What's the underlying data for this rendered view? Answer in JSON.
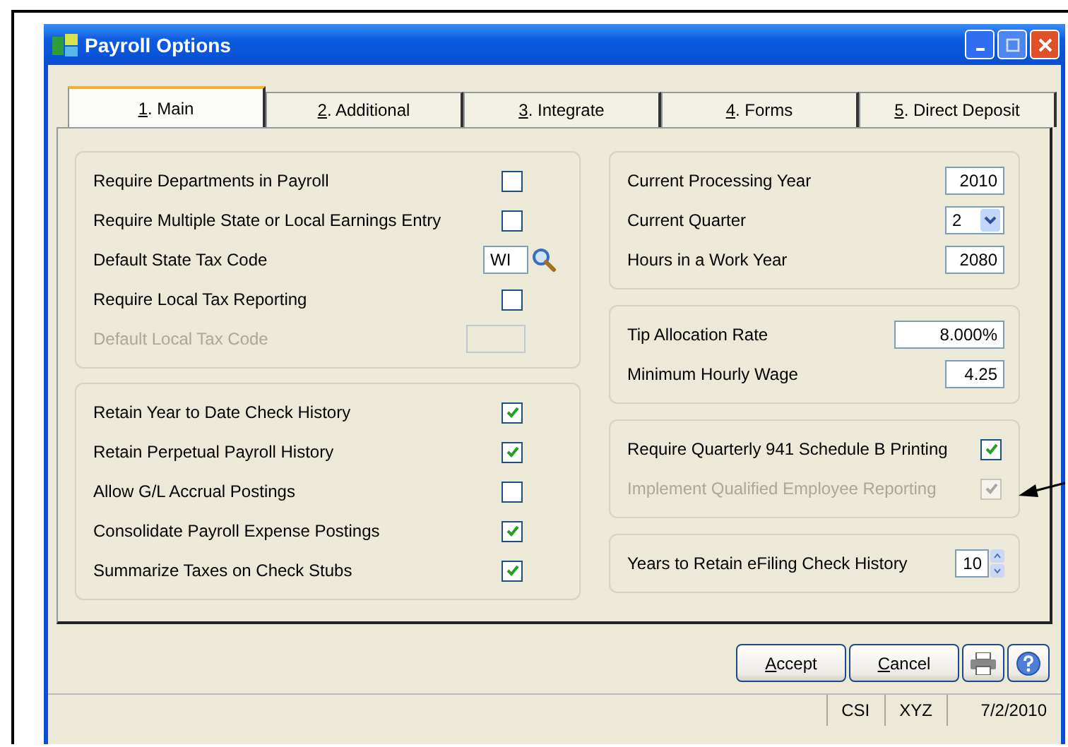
{
  "window": {
    "title": "Payroll Options"
  },
  "tabs": [
    {
      "label": "1. Main",
      "selected": true
    },
    {
      "label": "2. Additional",
      "selected": false
    },
    {
      "label": "3. Integrate",
      "selected": false
    },
    {
      "label": "4. Forms",
      "selected": false
    },
    {
      "label": "5. Direct Deposit",
      "selected": false
    }
  ],
  "left_groups": [
    {
      "items": [
        {
          "label": "Require Departments in Payroll",
          "kind": "checkbox",
          "checked": false,
          "disabled": false
        },
        {
          "label": "Require Multiple State or Local Earnings Entry",
          "kind": "checkbox",
          "checked": false,
          "disabled": false
        },
        {
          "label": "Default State Tax Code",
          "kind": "lookup",
          "value": "WI",
          "disabled": false
        },
        {
          "label": "Require Local Tax Reporting",
          "kind": "checkbox",
          "checked": false,
          "disabled": false
        },
        {
          "label": "Default Local Tax Code",
          "kind": "field",
          "disabled": true
        }
      ]
    },
    {
      "items": [
        {
          "label": "Retain Year to Date Check History",
          "kind": "checkbox",
          "checked": true,
          "disabled": false
        },
        {
          "label": "Retain Perpetual Payroll History",
          "kind": "checkbox",
          "checked": true,
          "disabled": false
        },
        {
          "label": "Allow G/L Accrual Postings",
          "kind": "checkbox",
          "checked": false,
          "disabled": false
        },
        {
          "label": "Consolidate Payroll Expense Postings",
          "kind": "checkbox",
          "checked": true,
          "disabled": false
        },
        {
          "label": "Summarize Taxes on Check Stubs",
          "kind": "checkbox",
          "checked": true,
          "disabled": false
        }
      ]
    }
  ],
  "right_groups": [
    {
      "items": [
        {
          "label": "Current Processing Year",
          "kind": "field",
          "value": "2010",
          "disabled": false
        },
        {
          "label": "Current Quarter",
          "kind": "dropdown",
          "value": "2",
          "disabled": false
        },
        {
          "label": "Hours in a Work Year",
          "kind": "field",
          "value": "2080",
          "disabled": false
        }
      ]
    },
    {
      "items": [
        {
          "label": "Tip Allocation Rate",
          "kind": "wide-field",
          "value": "8.000%",
          "disabled": false
        },
        {
          "label": "Minimum Hourly Wage",
          "kind": "field",
          "value": "4.25",
          "disabled": false
        }
      ]
    },
    {
      "items": [
        {
          "label": "Require Quarterly 941 Schedule B Printing",
          "kind": "checkbox",
          "checked": true,
          "disabled": false,
          "pointed": false
        },
        {
          "label": "Implement Qualified Employee Reporting",
          "kind": "checkbox",
          "checked": true,
          "disabled": true,
          "pointed": true
        }
      ]
    },
    {
      "items": [
        {
          "label": "Years to Retain eFiling Check History",
          "kind": "spinner",
          "value": "10",
          "disabled": false
        }
      ]
    }
  ],
  "buttons": [
    {
      "label": "Accept"
    },
    {
      "label": "Cancel"
    }
  ],
  "status_bar": [
    "CSI",
    "XYZ",
    "7/2/2010"
  ]
}
